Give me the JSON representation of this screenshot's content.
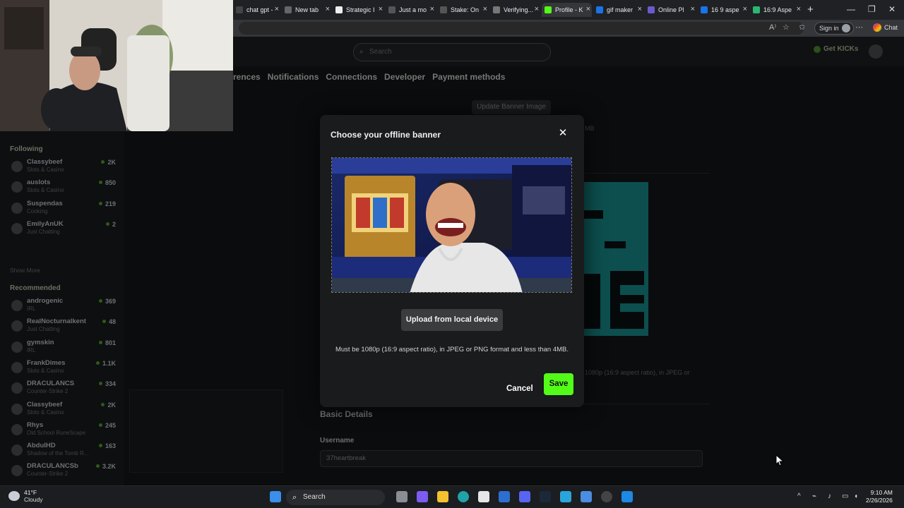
{
  "browser": {
    "tabs": [
      {
        "label": "chat gpt -",
        "fav_color": "#444"
      },
      {
        "label": "New tab",
        "fav_color": "#666"
      },
      {
        "label": "Strategic I",
        "fav_color": "#eee"
      },
      {
        "label": "Just a mo",
        "fav_color": "#555"
      },
      {
        "label": "Stake: On",
        "fav_color": "#555"
      },
      {
        "label": "Verifying...",
        "fav_color": "#777"
      },
      {
        "label": "Profile - K",
        "fav_color": "#53fc18"
      },
      {
        "label": "gif maker",
        "fav_color": "#1a73e8"
      },
      {
        "label": "Online Pl",
        "fav_color": "#6a5acd"
      },
      {
        "label": "16 9 aspe",
        "fav_color": "#1a73e8"
      },
      {
        "label": "16:9 Aspe",
        "fav_color": "#2bb673"
      }
    ],
    "active_tab": 6,
    "sign_in_label": "Sign in",
    "chat_label": "Chat"
  },
  "site": {
    "search_placeholder": "Search",
    "get_kicks_label": "Get KICKs",
    "settings_tabs": [
      "rences",
      "Notifications",
      "Connections",
      "Developer",
      "Payment methods"
    ]
  },
  "sidebar": {
    "following_heading": "Following",
    "following": [
      {
        "name": "Classybeef",
        "category": "Slots & Casino",
        "viewers": "2K"
      },
      {
        "name": "auslots",
        "category": "Slots & Casino",
        "viewers": "850"
      },
      {
        "name": "Suspendas",
        "category": "Cooking",
        "viewers": "219"
      },
      {
        "name": "EmilyAnUK",
        "category": "Just Chatting",
        "viewers": "2"
      }
    ],
    "show_more_label": "Show More",
    "recommended_heading": "Recommended",
    "recommended": [
      {
        "name": "androgenic",
        "category": "IRL",
        "viewers": "369"
      },
      {
        "name": "RealNocturnalkent",
        "category": "Just Chatting",
        "viewers": "48"
      },
      {
        "name": "gymskin",
        "category": "IRL",
        "viewers": "801"
      },
      {
        "name": "FrankDimes",
        "category": "Slots & Casino",
        "viewers": "1.1K"
      },
      {
        "name": "DRACULANCS",
        "category": "Counter-Strike 2",
        "viewers": "334"
      },
      {
        "name": "Classybeef",
        "category": "Slots & Casino",
        "viewers": "2K"
      },
      {
        "name": "Rhys",
        "category": "Old School RuneScape",
        "viewers": "245"
      },
      {
        "name": "AbdulHD",
        "category": "Shadow of the Tomb R...",
        "viewers": "163"
      },
      {
        "name": "DRACULANCSb",
        "category": "Counter-Strike 2",
        "viewers": "3.2K"
      }
    ]
  },
  "profile": {
    "update_banner_label": "Update Banner Image",
    "banner_size_fragment": "MB",
    "banner_hint_fragment": "1080p (16:9 aspect ratio), in JPEG or",
    "basic_details_heading": "Basic Details",
    "username_label": "Username",
    "username_value": "37heartbreak"
  },
  "modal": {
    "title": "Choose your offline banner",
    "close_glyph": "✕",
    "upload_label": "Upload from local device",
    "hint": "Must be 1080p (16:9 aspect ratio), in JPEG or PNG format and less than 4MB.",
    "cancel_label": "Cancel",
    "save_label": "Save",
    "accent": "#53fc18"
  },
  "taskbar": {
    "temperature": "41°F",
    "weather": "Cloudy",
    "search_label": "Search",
    "time": "9:10 AM",
    "date": "2/26/2026"
  }
}
